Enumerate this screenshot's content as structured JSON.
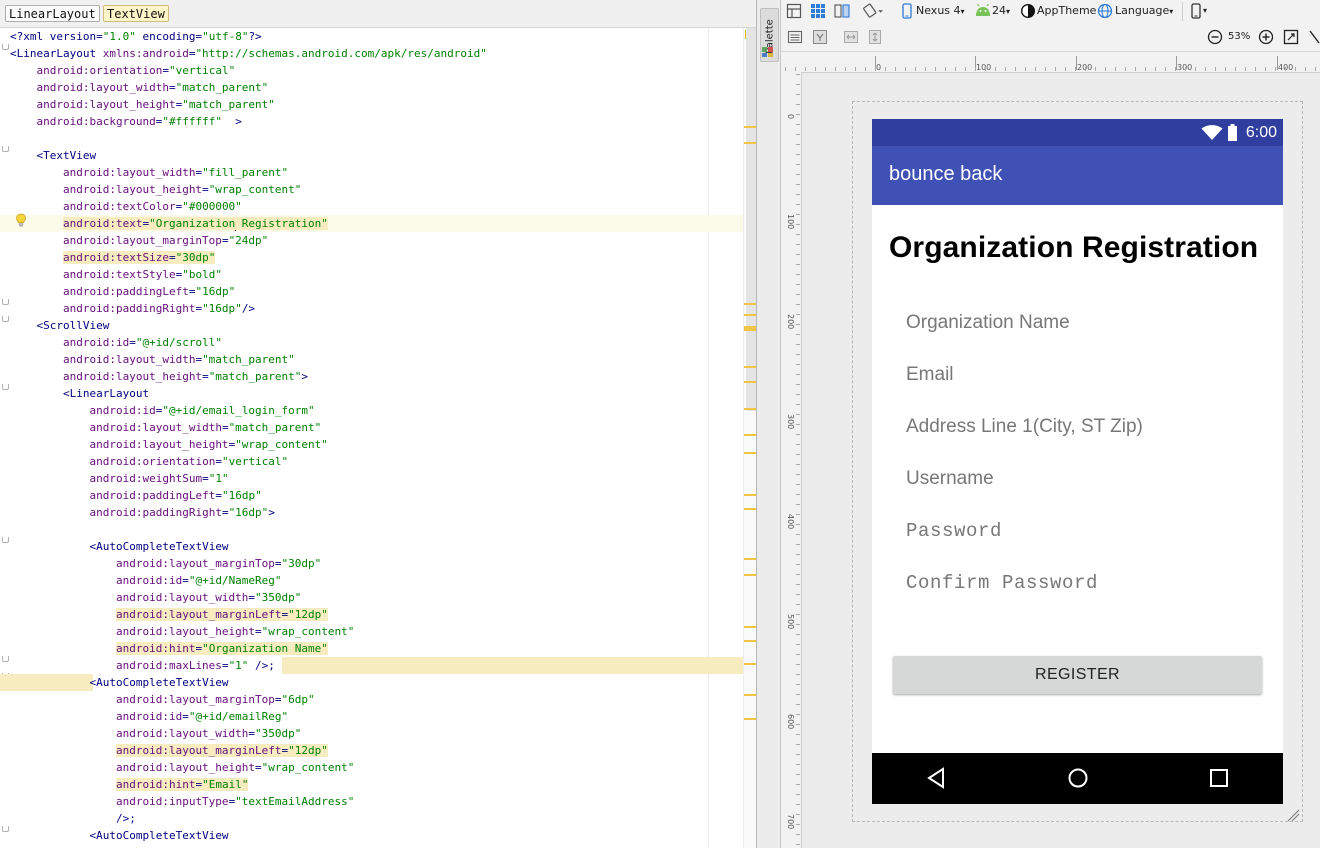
{
  "breadcrumbs": [
    "LinearLayout",
    "TextView"
  ],
  "code_lines": [
    [
      [
        "t",
        "<?xml version="
      ],
      [
        "v",
        "\"1.0\""
      ],
      [
        "t",
        " encoding="
      ],
      [
        "v",
        "\"utf-8\""
      ],
      [
        "t",
        "?>"
      ]
    ],
    [
      [
        "t",
        "<LinearLayout "
      ],
      [
        "a",
        "xmlns:android"
      ],
      [
        "t",
        "="
      ],
      [
        "v",
        "\"http://schemas.android.com/apk/res/android\""
      ]
    ],
    [
      [
        "p",
        "    "
      ],
      [
        "a",
        "android:orientation"
      ],
      [
        "t",
        "="
      ],
      [
        "v",
        "\"vertical\""
      ]
    ],
    [
      [
        "p",
        "    "
      ],
      [
        "a",
        "android:layout_width"
      ],
      [
        "t",
        "="
      ],
      [
        "v",
        "\"match_parent\""
      ]
    ],
    [
      [
        "p",
        "    "
      ],
      [
        "a",
        "android:layout_height"
      ],
      [
        "t",
        "="
      ],
      [
        "v",
        "\"match_parent\""
      ]
    ],
    [
      [
        "p",
        "    "
      ],
      [
        "a",
        "android:background"
      ],
      [
        "t",
        "="
      ],
      [
        "v",
        "\"#ffffff\""
      ],
      [
        "t",
        "  >"
      ]
    ],
    [],
    [
      [
        "p",
        "    "
      ],
      [
        "t",
        "<TextView"
      ]
    ],
    [
      [
        "p",
        "        "
      ],
      [
        "a",
        "android:layout_width"
      ],
      [
        "t",
        "="
      ],
      [
        "v",
        "\"fill_parent\""
      ]
    ],
    [
      [
        "p",
        "        "
      ],
      [
        "a",
        "android:layout_height"
      ],
      [
        "t",
        "="
      ],
      [
        "v",
        "\"wrap_content\""
      ]
    ],
    [
      [
        "p",
        "        "
      ],
      [
        "a",
        "android:textColor"
      ],
      [
        "t",
        "="
      ],
      [
        "v",
        "\"#000000\""
      ]
    ],
    [
      [
        "p",
        "        "
      ],
      [
        "ah",
        "android:text"
      ],
      [
        "th",
        "="
      ],
      [
        "vh",
        "\"Organization"
      ],
      [
        "caret",
        ""
      ],
      [
        "vh",
        " Registration\""
      ]
    ],
    [
      [
        "p",
        "        "
      ],
      [
        "a",
        "android:layout_marginTop"
      ],
      [
        "t",
        "="
      ],
      [
        "v",
        "\"24dp\""
      ]
    ],
    [
      [
        "p",
        "        "
      ],
      [
        "ah",
        "android:textSize"
      ],
      [
        "th",
        "="
      ],
      [
        "vh",
        "\"30dp\""
      ]
    ],
    [
      [
        "p",
        "        "
      ],
      [
        "a",
        "android:textStyle"
      ],
      [
        "t",
        "="
      ],
      [
        "v",
        "\"bold\""
      ]
    ],
    [
      [
        "p",
        "        "
      ],
      [
        "a",
        "android:paddingLeft"
      ],
      [
        "t",
        "="
      ],
      [
        "v",
        "\"16dp\""
      ]
    ],
    [
      [
        "p",
        "        "
      ],
      [
        "a",
        "android:paddingRight"
      ],
      [
        "t",
        "="
      ],
      [
        "v",
        "\"16dp\""
      ],
      [
        "t",
        "/>"
      ]
    ],
    [
      [
        "p",
        "    "
      ],
      [
        "t",
        "<ScrollView"
      ]
    ],
    [
      [
        "p",
        "        "
      ],
      [
        "a",
        "android:id"
      ],
      [
        "t",
        "="
      ],
      [
        "v",
        "\"@+id/scroll\""
      ]
    ],
    [
      [
        "p",
        "        "
      ],
      [
        "a",
        "android:layout_width"
      ],
      [
        "t",
        "="
      ],
      [
        "v",
        "\"match_parent\""
      ]
    ],
    [
      [
        "p",
        "        "
      ],
      [
        "a",
        "android:layout_height"
      ],
      [
        "t",
        "="
      ],
      [
        "v",
        "\"match_parent\""
      ],
      [
        "t",
        ">"
      ]
    ],
    [
      [
        "p",
        "        "
      ],
      [
        "t",
        "<LinearLayout"
      ]
    ],
    [
      [
        "p",
        "            "
      ],
      [
        "a",
        "android:id"
      ],
      [
        "t",
        "="
      ],
      [
        "v",
        "\"@+id/email_login_form\""
      ]
    ],
    [
      [
        "p",
        "            "
      ],
      [
        "a",
        "android:layout_width"
      ],
      [
        "t",
        "="
      ],
      [
        "v",
        "\"match_parent\""
      ]
    ],
    [
      [
        "p",
        "            "
      ],
      [
        "a",
        "android:layout_height"
      ],
      [
        "t",
        "="
      ],
      [
        "v",
        "\"wrap_content\""
      ]
    ],
    [
      [
        "p",
        "            "
      ],
      [
        "a",
        "android:orientation"
      ],
      [
        "t",
        "="
      ],
      [
        "v",
        "\"vertical\""
      ]
    ],
    [
      [
        "p",
        "            "
      ],
      [
        "a",
        "android:weightSum"
      ],
      [
        "t",
        "="
      ],
      [
        "v",
        "\"1\""
      ]
    ],
    [
      [
        "p",
        "            "
      ],
      [
        "a",
        "android:paddingLeft"
      ],
      [
        "t",
        "="
      ],
      [
        "v",
        "\"16dp\""
      ]
    ],
    [
      [
        "p",
        "            "
      ],
      [
        "a",
        "android:paddingRight"
      ],
      [
        "t",
        "="
      ],
      [
        "v",
        "\"16dp\""
      ],
      [
        "t",
        ">"
      ]
    ],
    [],
    [
      [
        "p",
        "            "
      ],
      [
        "t",
        "<AutoCompleteTextView"
      ]
    ],
    [
      [
        "p",
        "                "
      ],
      [
        "a",
        "android:layout_marginTop"
      ],
      [
        "t",
        "="
      ],
      [
        "v",
        "\"30dp\""
      ]
    ],
    [
      [
        "p",
        "                "
      ],
      [
        "a",
        "android:id"
      ],
      [
        "t",
        "="
      ],
      [
        "v",
        "\"@+id/NameReg\""
      ]
    ],
    [
      [
        "p",
        "                "
      ],
      [
        "a",
        "android:layout_width"
      ],
      [
        "t",
        "="
      ],
      [
        "v",
        "\"350dp\""
      ]
    ],
    [
      [
        "p",
        "                "
      ],
      [
        "ah",
        "android:layout_marginLeft"
      ],
      [
        "th",
        "="
      ],
      [
        "vh",
        "\"12dp\""
      ]
    ],
    [
      [
        "p",
        "                "
      ],
      [
        "a",
        "android:layout_height"
      ],
      [
        "t",
        "="
      ],
      [
        "v",
        "\"wrap_content\""
      ]
    ],
    [
      [
        "p",
        "                "
      ],
      [
        "ah",
        "android:hint"
      ],
      [
        "th",
        "="
      ],
      [
        "vh",
        "\"Organization Name\""
      ]
    ],
    [
      [
        "p",
        "                "
      ],
      [
        "a",
        "android:maxLines"
      ],
      [
        "t",
        "="
      ],
      [
        "v",
        "\"1\""
      ],
      [
        "t",
        " />;"
      ]
    ],
    [
      [
        "p",
        "            "
      ],
      [
        "t",
        "<AutoCompleteTextView"
      ]
    ],
    [
      [
        "p",
        "                "
      ],
      [
        "a",
        "android:layout_marginTop"
      ],
      [
        "t",
        "="
      ],
      [
        "v",
        "\"6dp\""
      ]
    ],
    [
      [
        "p",
        "                "
      ],
      [
        "a",
        "android:id"
      ],
      [
        "t",
        "="
      ],
      [
        "v",
        "\"@+id/emailReg\""
      ]
    ],
    [
      [
        "p",
        "                "
      ],
      [
        "a",
        "android:layout_width"
      ],
      [
        "t",
        "="
      ],
      [
        "v",
        "\"350dp\""
      ]
    ],
    [
      [
        "p",
        "                "
      ],
      [
        "ah",
        "android:layout_marginLeft"
      ],
      [
        "th",
        "="
      ],
      [
        "vh",
        "\"12dp\""
      ]
    ],
    [
      [
        "p",
        "                "
      ],
      [
        "a",
        "android:layout_height"
      ],
      [
        "t",
        "="
      ],
      [
        "v",
        "\"wrap_content\""
      ]
    ],
    [
      [
        "p",
        "                "
      ],
      [
        "ah",
        "android:hint"
      ],
      [
        "th",
        "="
      ],
      [
        "vh",
        "\"Email\""
      ]
    ],
    [
      [
        "p",
        "                "
      ],
      [
        "a",
        "android:inputType"
      ],
      [
        "t",
        "="
      ],
      [
        "v",
        "\"textEmailAddress\""
      ]
    ],
    [
      [
        "p",
        "                "
      ],
      [
        "t",
        "/>;"
      ]
    ],
    [
      [
        "p",
        "            "
      ],
      [
        "t",
        "<AutoCompleteTextView"
      ]
    ]
  ],
  "side_tab": "Palette",
  "toolbar": {
    "device": "Nexus 4",
    "api": "24",
    "theme": "AppTheme",
    "language": "Language",
    "zoom": "53%"
  },
  "ruler": {
    "h": [
      "0",
      "100",
      "200",
      "300",
      "400"
    ],
    "v": [
      "0",
      "100",
      "200",
      "300",
      "400",
      "500",
      "600",
      "700"
    ]
  },
  "preview": {
    "time": "6:00",
    "app_title": "bounce back",
    "heading": "Organization Registration",
    "hints": [
      "Organization Name",
      "Email",
      "Address Line 1(City, ST Zip)",
      "Username",
      "Password",
      "Confirm Password"
    ],
    "button": "REGISTER"
  },
  "colors": {
    "status_bar": "#303f9f",
    "app_bar": "#3f51b5",
    "nav_bar": "#000000",
    "xml_tag": "#000080",
    "xml_attr": "#660e7a",
    "xml_value": "#008000"
  }
}
